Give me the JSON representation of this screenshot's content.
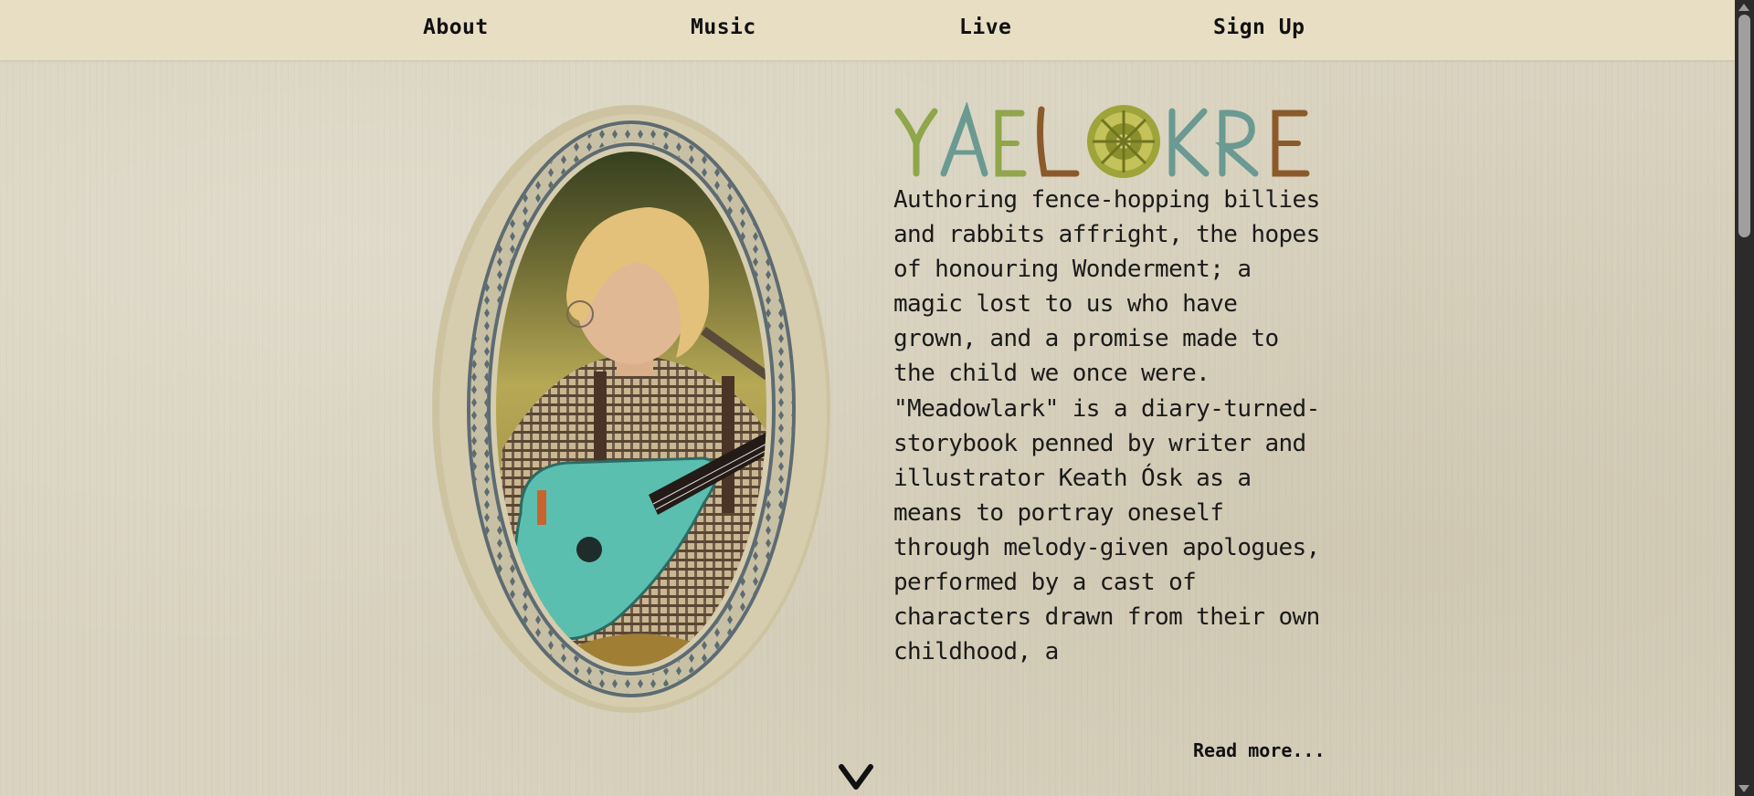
{
  "nav": {
    "about": "About",
    "music": "Music",
    "live": "Live",
    "signup": "Sign Up"
  },
  "logo": {
    "text": "YAELOKRE"
  },
  "intro": {
    "text": "Authoring fence-hopping billies and rabbits affright, the hopes of honouring Wonderment; a magic lost to us who have grown, and a promise made to the child we once were. \"Meadowlark\" is a diary-turned-storybook penned by writer and illustrator Keath Ósk as a means to portray oneself through melody-given apologues, performed by a cast of characters drawn from their own childhood, a",
    "read_more": "Read more..."
  },
  "colors": {
    "nav_bg": "#e8dec4",
    "page_bg": "#d9d3bf",
    "logo_green": "#8fa64a",
    "logo_teal": "#6a9a92",
    "logo_brown": "#8b5a2b",
    "ukulele": "#5bbfb0",
    "frame": "#5d6b72"
  },
  "icons": {
    "scroll_down": "chevron-down-icon"
  }
}
